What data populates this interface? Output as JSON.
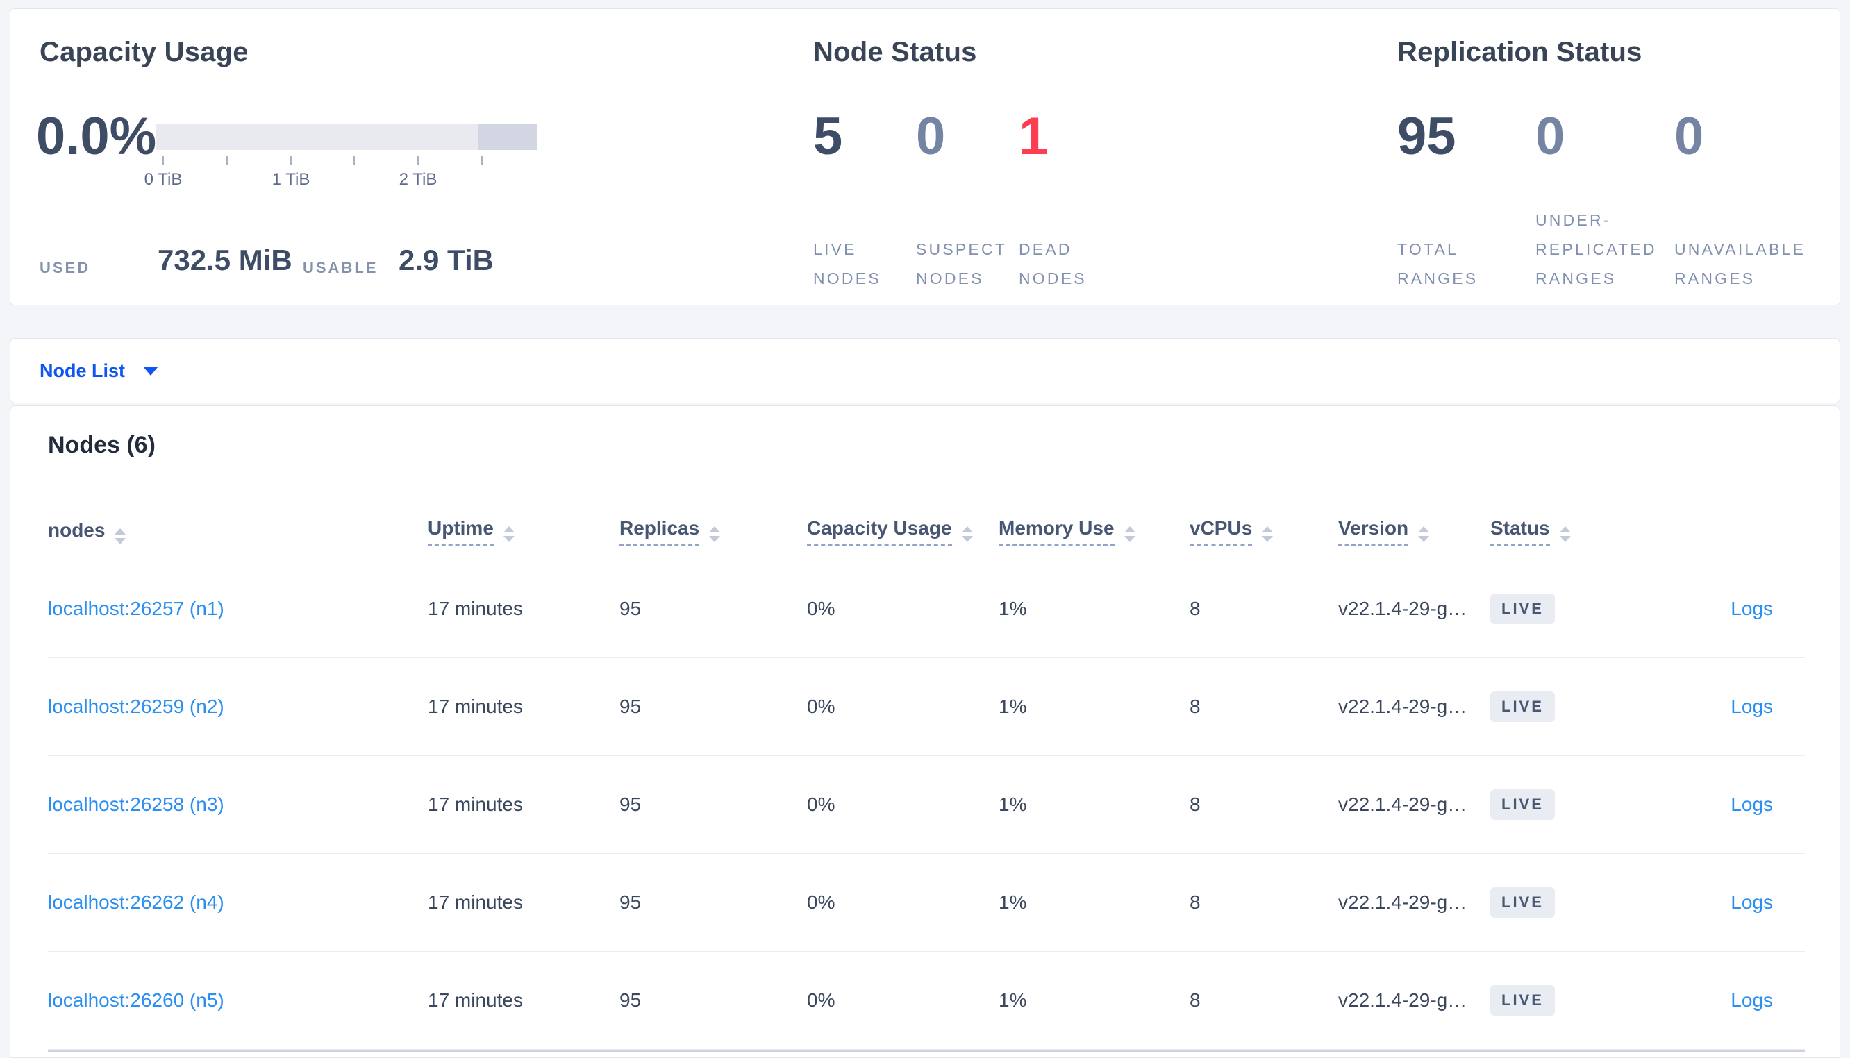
{
  "capacity_panel": {
    "title": "Capacity Usage",
    "percent": "0.0%",
    "tick_labels": [
      "0 TiB",
      "1 TiB",
      "2 TiB"
    ],
    "used_label": "USED",
    "used_value": "732.5 MiB",
    "usable_label": "USABLE",
    "usable_value": "2.9 TiB"
  },
  "node_status_panel": {
    "title": "Node Status",
    "stats": [
      {
        "value": "5",
        "label": "LIVE\nNODES"
      },
      {
        "value": "0",
        "label": "SUSPECT\nNODES"
      },
      {
        "value": "1",
        "label": "DEAD\nNODES"
      }
    ]
  },
  "replication_panel": {
    "title": "Replication Status",
    "stats": [
      {
        "value": "95",
        "label": "TOTAL\nRANGES"
      },
      {
        "value": "0",
        "label": "UNDER-\nREPLICATED\nRANGES"
      },
      {
        "value": "0",
        "label": "UNAVAILABLE\nRANGES"
      }
    ]
  },
  "node_list_bar": {
    "label": "Node List"
  },
  "nodes_table": {
    "title": "Nodes (6)",
    "columns": [
      {
        "label": "nodes"
      },
      {
        "label": "Uptime"
      },
      {
        "label": "Replicas"
      },
      {
        "label": "Capacity Usage"
      },
      {
        "label": "Memory Use"
      },
      {
        "label": "vCPUs"
      },
      {
        "label": "Version"
      },
      {
        "label": "Status"
      }
    ],
    "logs_label": "Logs",
    "rows": [
      {
        "node": "localhost:26257 (n1)",
        "uptime": "17 minutes",
        "replicas": "95",
        "capacity": "0%",
        "memory": "1%",
        "vcpus": "8",
        "version": "v22.1.4-29-g…",
        "status": "LIVE"
      },
      {
        "node": "localhost:26259 (n2)",
        "uptime": "17 minutes",
        "replicas": "95",
        "capacity": "0%",
        "memory": "1%",
        "vcpus": "8",
        "version": "v22.1.4-29-g…",
        "status": "LIVE"
      },
      {
        "node": "localhost:26258 (n3)",
        "uptime": "17 minutes",
        "replicas": "95",
        "capacity": "0%",
        "memory": "1%",
        "vcpus": "8",
        "version": "v22.1.4-29-g…",
        "status": "LIVE"
      },
      {
        "node": "localhost:26262 (n4)",
        "uptime": "17 minutes",
        "replicas": "95",
        "capacity": "0%",
        "memory": "1%",
        "vcpus": "8",
        "version": "v22.1.4-29-g…",
        "status": "LIVE"
      },
      {
        "node": "localhost:26260 (n5)",
        "uptime": "17 minutes",
        "replicas": "95",
        "capacity": "0%",
        "memory": "1%",
        "vcpus": "8",
        "version": "v22.1.4-29-g…",
        "status": "LIVE"
      }
    ]
  },
  "colors": {
    "accent_blue": "#0f55f2",
    "link_blue": "#2b8ff0",
    "status_red": "#fd3d52",
    "stat_dark": "#3e4c66",
    "stat_muted": "#7684a4"
  }
}
